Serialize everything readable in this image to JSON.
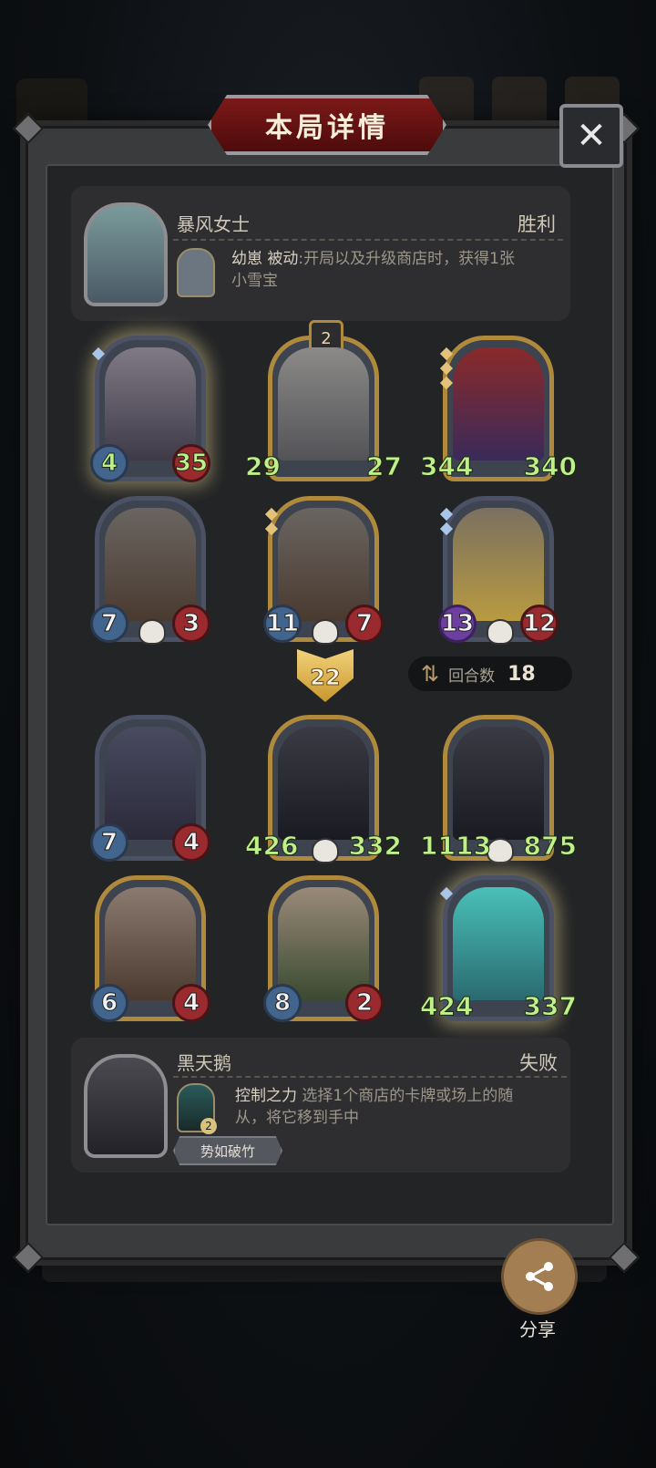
{
  "title": "本局详情",
  "close_label": "✕",
  "player_hero": {
    "name": "暴风女士",
    "result": "胜利",
    "skill_name": "幼崽",
    "skill_type": "被动",
    "skill_desc_line1": ":开局以及升级商店时，获得1张",
    "skill_desc_line2": "小雪宝"
  },
  "player_board": [
    {
      "attack": "4",
      "health": "35",
      "frame": "blue",
      "glow": true,
      "skull": false
    },
    {
      "attack": "29",
      "health": "27",
      "frame": "gold",
      "glow": false,
      "skull": false,
      "badge": "2"
    },
    {
      "attack": "344",
      "health": "340",
      "frame": "gold",
      "glow": false,
      "skull": false
    },
    {
      "attack": "7",
      "health": "3",
      "frame": "blue",
      "glow": false,
      "skull": true
    },
    {
      "attack": "11",
      "health": "7",
      "frame": "gold",
      "glow": false,
      "skull": true
    },
    {
      "attack": "13",
      "health": "12",
      "frame": "blue",
      "glow": false,
      "skull": true
    }
  ],
  "level": "22",
  "rounds": {
    "label": "回合数",
    "value": "18",
    "icon": "swap-arrows-icon"
  },
  "enemy_board": [
    {
      "attack": "7",
      "health": "4",
      "frame": "blue",
      "glow": false,
      "skull": false
    },
    {
      "attack": "426",
      "health": "332",
      "frame": "gold",
      "glow": false,
      "skull": true
    },
    {
      "attack": "1113",
      "health": "875",
      "frame": "gold",
      "glow": false,
      "skull": true
    },
    {
      "attack": "6",
      "health": "4",
      "frame": "gold",
      "glow": false,
      "skull": false
    },
    {
      "attack": "8",
      "health": "2",
      "frame": "gold",
      "glow": false,
      "skull": false
    },
    {
      "attack": "424",
      "health": "337",
      "frame": "blue",
      "glow": true,
      "skull": false
    }
  ],
  "enemy_hero": {
    "name": "黑天鹅",
    "result": "失败",
    "skill_name": "控制之力",
    "skill_desc_line1": "选择1个商店的卡牌或场上的随",
    "skill_desc_line2": "从，将它移到手中",
    "skill_cost": "2",
    "tag": "势如破竹"
  },
  "share_label": "分享",
  "colors": {
    "accent_gold": "#b08a3c",
    "stat_green": "#bff08a",
    "banner_red": "#7c1919"
  }
}
